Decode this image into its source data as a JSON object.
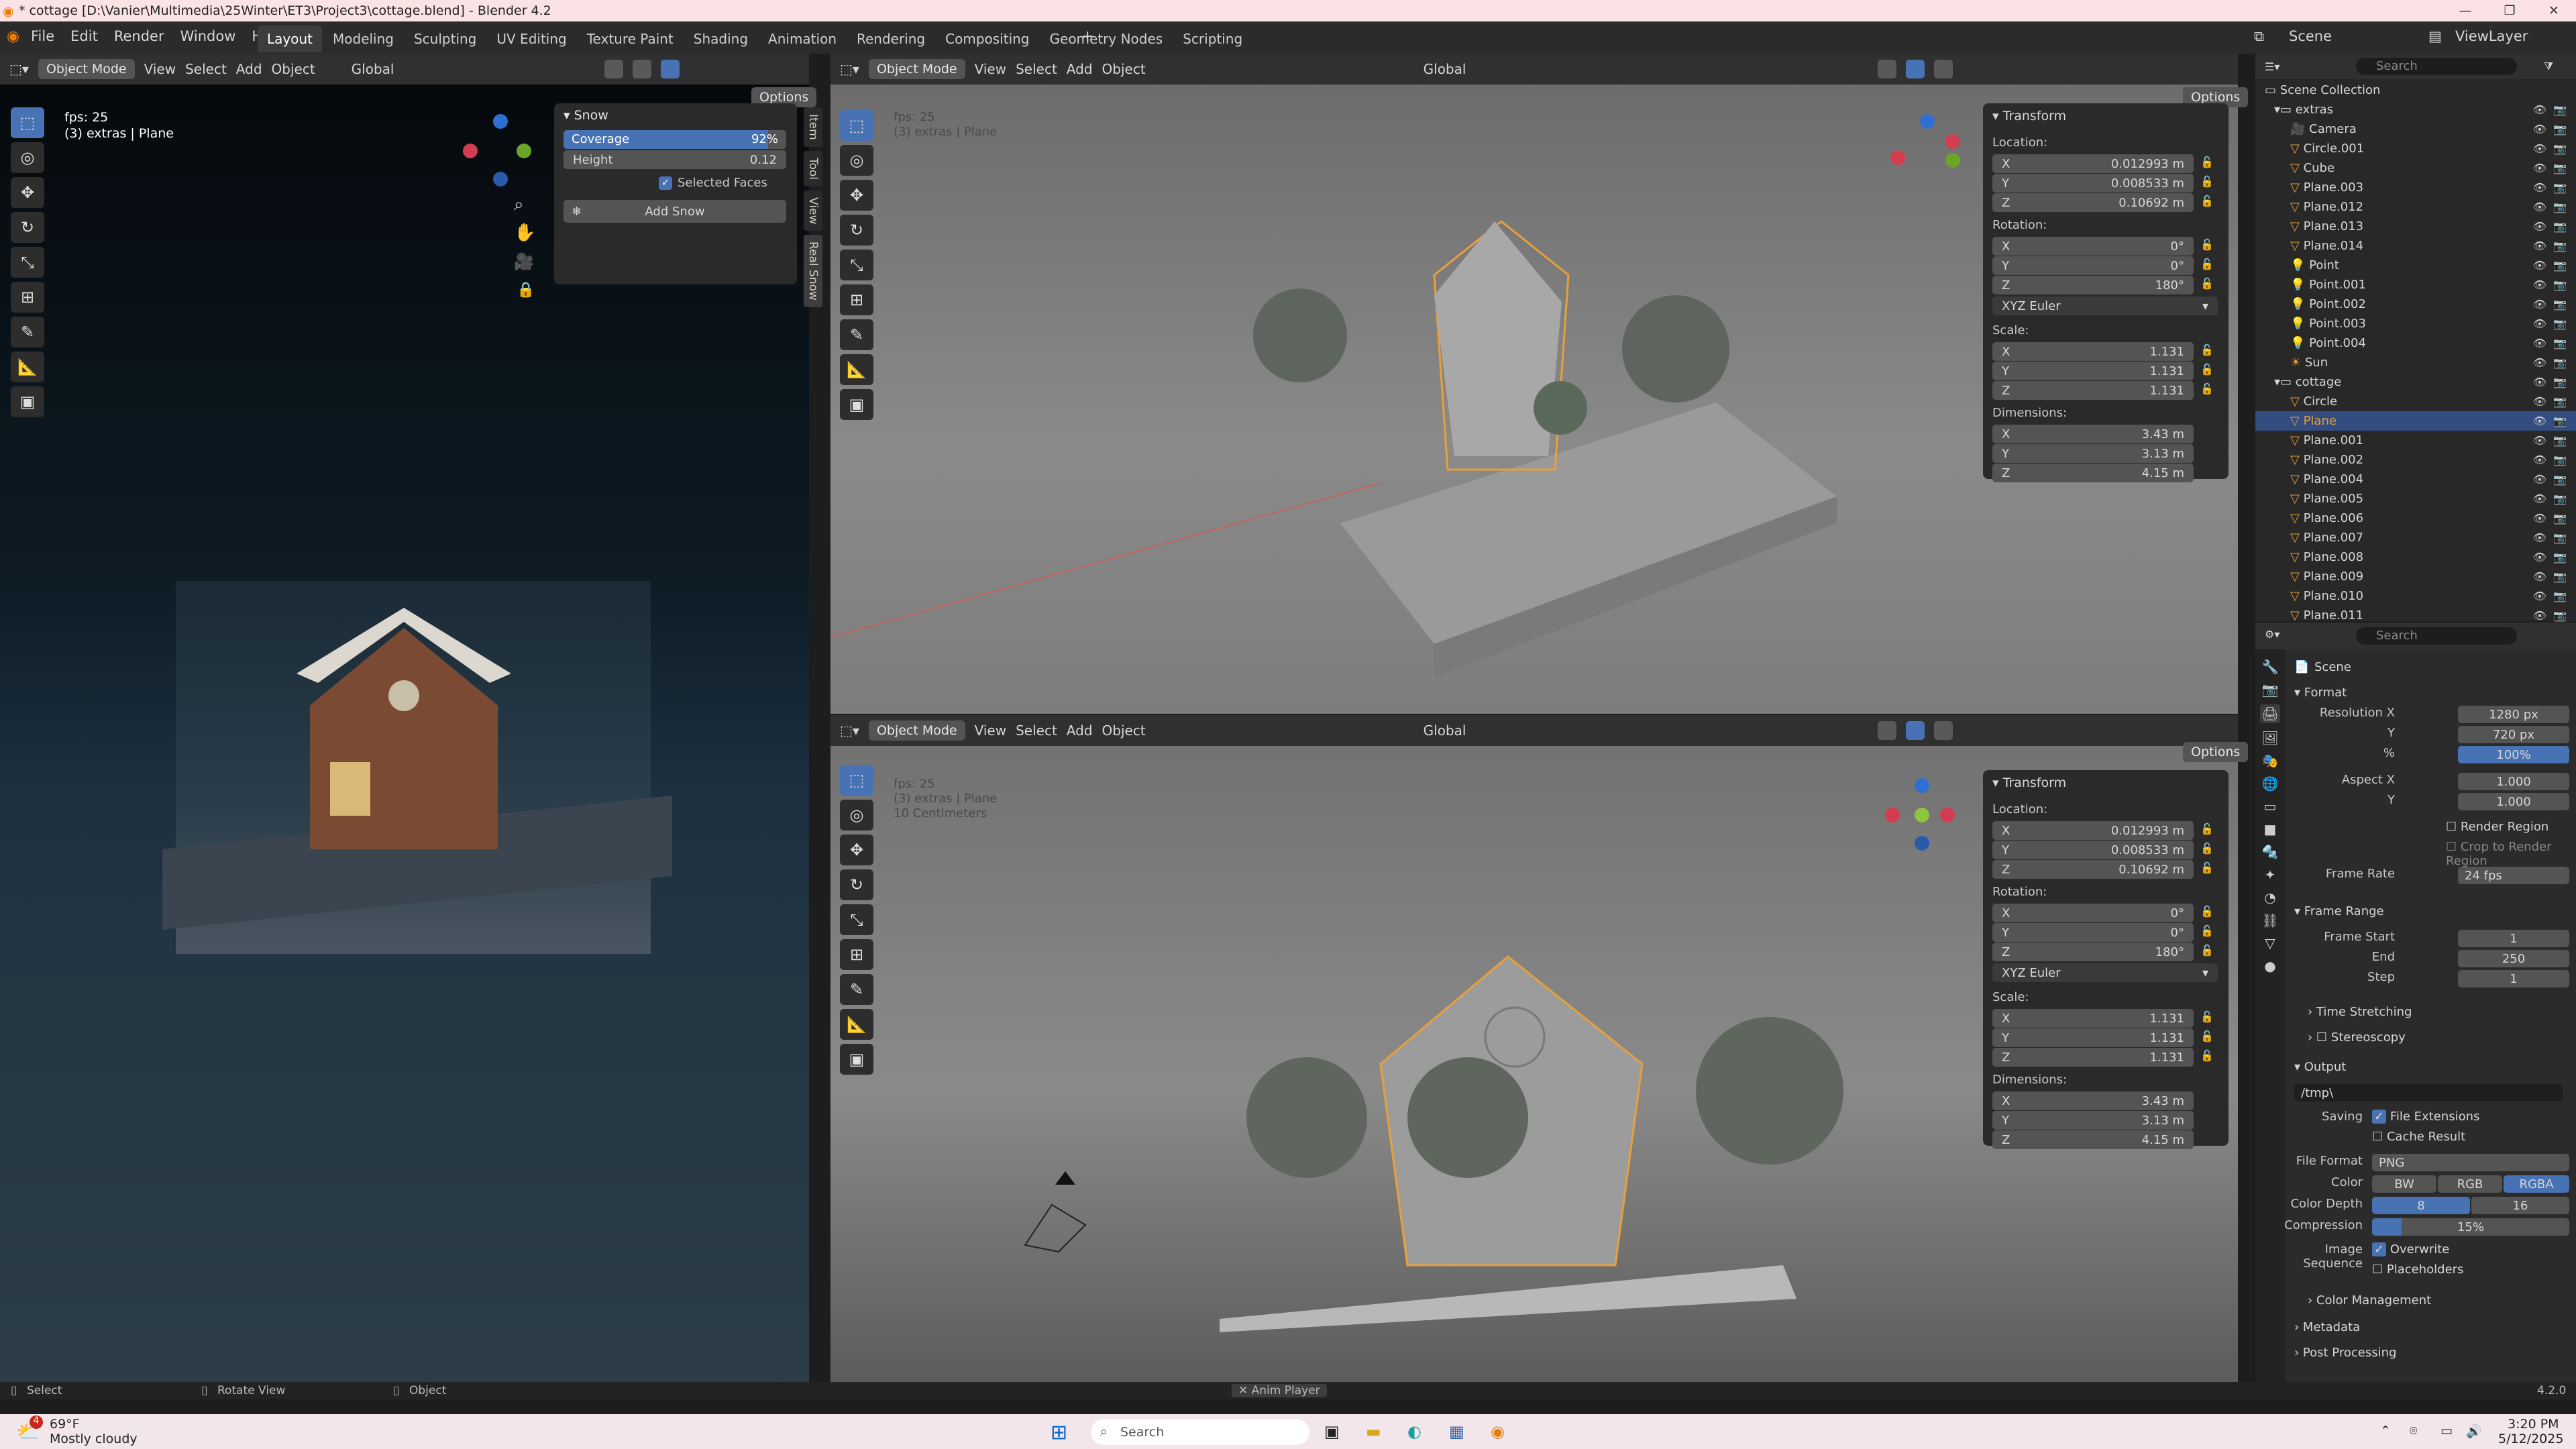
{
  "title_bar": {
    "title": "* cottage [D:\\Vanier\\Multimedia\\25Winter\\ET3\\Project3\\cottage.blend] - Blender 4.2"
  },
  "menu": {
    "items": [
      "File",
      "Edit",
      "Render",
      "Window",
      "Help"
    ]
  },
  "workspaces": {
    "tabs": [
      "Layout",
      "Modeling",
      "Sculpting",
      "UV Editing",
      "Texture Paint",
      "Shading",
      "Animation",
      "Rendering",
      "Compositing",
      "Geometry Nodes",
      "Scripting"
    ],
    "active": "Layout"
  },
  "top_right": {
    "scene": "Scene",
    "viewlayer": "ViewLayer"
  },
  "left_view": {
    "mode": "Object Mode",
    "menus": [
      "View",
      "Select",
      "Add",
      "Object"
    ],
    "orientation": "Global",
    "options": "Options",
    "fps": "fps: 25",
    "obj_info": "(3) extras | Plane",
    "snow_panel": {
      "title": "Snow",
      "coverage_label": "Coverage",
      "coverage": "92%",
      "coverage_frac": 0.92,
      "height_label": "Height",
      "height": "0.12",
      "selected_faces": "Selected Faces",
      "add_snow": "Add Snow"
    },
    "side_tabs": [
      "Item",
      "Tool",
      "View",
      "Real Snow"
    ]
  },
  "top_view": {
    "mode": "Object Mode",
    "menus": [
      "View",
      "Select",
      "Add",
      "Object"
    ],
    "orientation": "Global",
    "options": "Options",
    "fps": "fps: 25",
    "obj_info": "(3) extras | Plane"
  },
  "bottom_view": {
    "mode": "Object Mode",
    "menus": [
      "View",
      "Select",
      "Add",
      "Object"
    ],
    "orientation": "Global",
    "options": "Options",
    "fps": "fps: 25",
    "obj_info": "(3) extras | Plane",
    "scale_info": "10 Centimeters"
  },
  "transform": {
    "title": "Transform",
    "location_label": "Location:",
    "location": {
      "x": "0.012993 m",
      "y": "0.008533 m",
      "z": "0.10692 m"
    },
    "rotation_label": "Rotation:",
    "rotation": {
      "x": "0°",
      "y": "0°",
      "z": "180°"
    },
    "euler": "XYZ Euler",
    "scale_label": "Scale:",
    "scale": {
      "x": "1.131",
      "y": "1.131",
      "z": "1.131"
    },
    "dimensions_label": "Dimensions:",
    "dimensions": {
      "x": "3.43 m",
      "y": "3.13 m",
      "z": "4.15 m"
    },
    "axes": [
      "X",
      "Y",
      "Z"
    ]
  },
  "outliner": {
    "search": "Search",
    "root": "Scene Collection",
    "collections": [
      {
        "name": "extras",
        "items": [
          "Camera",
          "Circle.001",
          "Cube",
          "Plane.003",
          "Plane.012",
          "Plane.013",
          "Plane.014",
          "Point",
          "Point.001",
          "Point.002",
          "Point.003",
          "Point.004",
          "Sun"
        ]
      },
      {
        "name": "cottage",
        "items": [
          "Circle",
          "Plane",
          "Plane.001",
          "Plane.002",
          "Plane.004",
          "Plane.005",
          "Plane.006",
          "Plane.007",
          "Plane.008",
          "Plane.009",
          "Plane.010",
          "Plane.011"
        ]
      }
    ],
    "selected": "Plane"
  },
  "properties": {
    "search": "Search",
    "context": "Scene",
    "format": {
      "title": "Format",
      "res_x_label": "Resolution X",
      "res_x": "1280 px",
      "y_label": "Y",
      "res_y": "720 px",
      "pct_label": "%",
      "pct": "100%",
      "aspect_x_label": "Aspect X",
      "aspect_x": "1.000",
      "aspect_y": "1.000",
      "render_region": "Render Region",
      "crop": "Crop to Render Region",
      "frame_rate_label": "Frame Rate",
      "frame_rate": "24 fps"
    },
    "frame_range": {
      "title": "Frame Range",
      "start_label": "Frame Start",
      "start": "1",
      "end_label": "End",
      "end": "250",
      "step_label": "Step",
      "step": "1"
    },
    "time_stretching": "Time Stretching",
    "stereoscopy": "Stereoscopy",
    "output": {
      "title": "Output",
      "path": "/tmp\\",
      "saving_label": "Saving",
      "file_ext": "File Extensions",
      "cache": "Cache Result",
      "format_label": "File Format",
      "format": "PNG",
      "color_label": "Color",
      "bw": "BW",
      "rgb": "RGB",
      "rgba": "RGBA",
      "depth_label": "Color Depth",
      "d8": "8",
      "d16": "16",
      "compression_label": "Compression",
      "compression": "15%",
      "compression_frac": 0.15,
      "seq_label": "Image Sequence",
      "overwrite": "Overwrite",
      "placeholders": "Placeholders",
      "color_mgmt": "Color Management"
    },
    "metadata": "Metadata",
    "post": "Post Processing"
  },
  "status": {
    "select": "Select",
    "rotate": "Rotate View",
    "object": "Object",
    "anim": "Anim Player",
    "version": "4.2.0"
  },
  "taskbar": {
    "weather_temp": "69°F",
    "weather_desc": "Mostly cloudy",
    "badge": "4",
    "search": "Search",
    "time": "3:20 PM",
    "date": "5/12/2025"
  },
  "colors": {
    "accent": "#4772b3",
    "selection": "#e8a03a",
    "bg": "#1d1d1d"
  }
}
